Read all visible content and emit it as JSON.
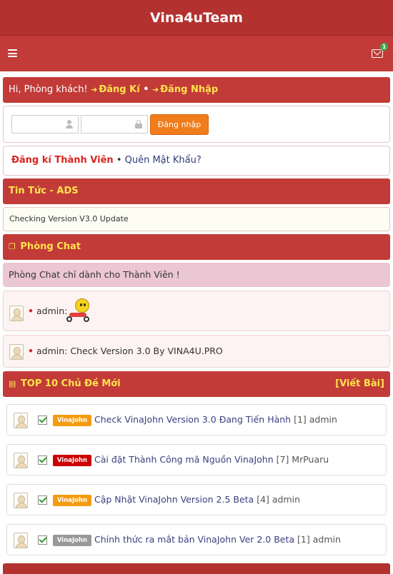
{
  "app": {
    "title": "Vina4uTeam"
  },
  "navbar": {
    "notification_count": "1"
  },
  "welcome": {
    "greeting": "Hi, Phòng khách!",
    "register_label": "Đăng Kí",
    "separator": "•",
    "login_label": "Đăng Nhập"
  },
  "login_form": {
    "username_value": "",
    "password_value": "",
    "submit_label": "Đăng nhập"
  },
  "register_box": {
    "register_label": "Đăng kí Thành Viên",
    "dot": "•",
    "forgot_label": "Quên Mật Khẩu?"
  },
  "news": {
    "header": "Tin Tức - ADS",
    "item": "Checking Version V3.0 Update"
  },
  "chat": {
    "header": "Phòng Chat",
    "notice": "Phòng Chat chỉ dành cho Thành Viên !",
    "messages": [
      {
        "bullet": "•",
        "text": "admin:"
      },
      {
        "bullet": "•",
        "text": "admin: Check Version 3.0 By VINA4U.PRO"
      }
    ]
  },
  "topics": {
    "header": "TOP 10 Chủ Đề Mới",
    "write_label": "[Viết Bài]",
    "items": [
      {
        "tag": "VinaJohn",
        "tag_color": "#f39c12",
        "title": "Check VinaJohn Version 3.0 Đang Tiến Hành",
        "meta": "[1] admin"
      },
      {
        "tag": "VinaJohn",
        "tag_color": "#cc0000",
        "title": "Cài đặt Thành Công mã Nguồn VinaJohn",
        "meta": "[7] MrPuaru"
      },
      {
        "tag": "VinaJohn",
        "tag_color": "#f39c12",
        "title": "Cập Nhật VinaJohn Version 2.5 Beta",
        "meta": "[4] admin"
      },
      {
        "tag": "VinaJohn",
        "tag_color": "#999999",
        "title": "Chính thức ra mắt bản VinaJohn Ver 2.0 Beta",
        "meta": "[1] admin"
      }
    ]
  },
  "colors": {
    "brand_red": "#c23b38",
    "accent_yellow": "#ffe34d",
    "button_orange": "#f07c1b"
  }
}
